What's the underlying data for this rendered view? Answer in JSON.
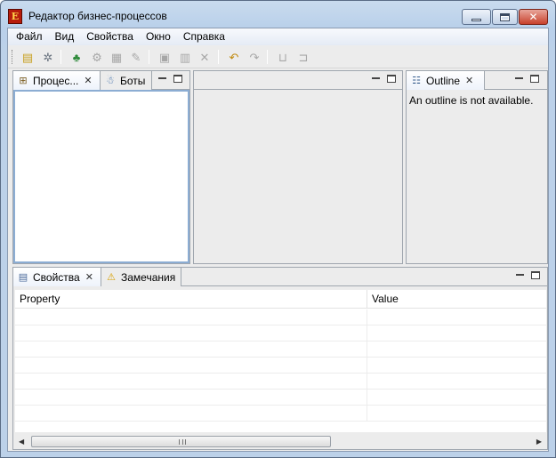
{
  "window": {
    "title": "Редактор бизнес-процессов",
    "app_icon_letter": "E"
  },
  "menubar": {
    "items": [
      "Файл",
      "Вид",
      "Свойства",
      "Окно",
      "Справка"
    ]
  },
  "panels": {
    "left": {
      "tabs": [
        {
          "label": "Процес...",
          "icon": "process-icon",
          "active": true
        },
        {
          "label": "Боты",
          "icon": "bots-icon",
          "active": false
        }
      ]
    },
    "outline": {
      "tab_label": "Outline",
      "message": "An outline is not available."
    },
    "bottom": {
      "tabs": [
        {
          "label": "Свойства",
          "icon": "properties-icon",
          "active": true
        },
        {
          "label": "Замечания",
          "icon": "warning-icon",
          "active": false
        }
      ],
      "table": {
        "columns": [
          "Property",
          "Value"
        ],
        "rows": []
      }
    }
  },
  "colors": {
    "title_gradient": "#bcd1e9",
    "accent_border": "#8cadd3",
    "close_button": "#c8412c"
  }
}
